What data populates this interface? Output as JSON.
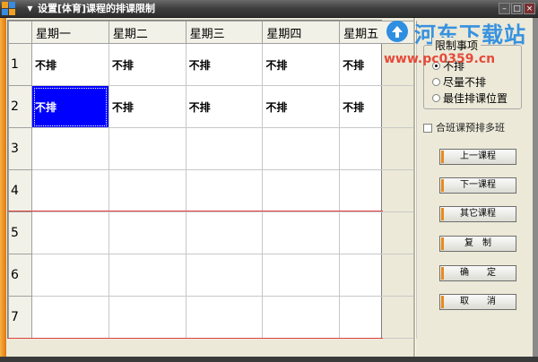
{
  "window": {
    "title": "设置[体育]课程的排课限制"
  },
  "timetable": {
    "day_headers": [
      "星期一",
      "星期二",
      "星期三",
      "星期四",
      "星期五"
    ],
    "rows": [
      {
        "label": "1",
        "cells": [
          "不排",
          "不排",
          "不排",
          "不排",
          "不排"
        ]
      },
      {
        "label": "2",
        "cells": [
          "不排",
          "不排",
          "不排",
          "不排",
          "不排"
        ]
      },
      {
        "label": "3",
        "cells": [
          "",
          "",
          "",
          "",
          ""
        ]
      },
      {
        "label": "4",
        "cells": [
          "",
          "",
          "",
          "",
          ""
        ]
      },
      {
        "label": "5",
        "cells": [
          "",
          "",
          "",
          "",
          ""
        ]
      },
      {
        "label": "6",
        "cells": [
          "",
          "",
          "",
          "",
          ""
        ]
      },
      {
        "label": "7",
        "cells": [
          "",
          "",
          "",
          "",
          ""
        ]
      }
    ],
    "selected_cell": {
      "row": 2,
      "day": 1
    }
  },
  "restrictions": {
    "group_title": "限制事项",
    "options": [
      {
        "label": "不排",
        "selected": true
      },
      {
        "label": "尽量不排",
        "selected": false
      },
      {
        "label": "最佳排课位置",
        "selected": false
      }
    ]
  },
  "merge_class": {
    "label": "合班课预排多班",
    "checked": false
  },
  "buttons": {
    "prev_course": "上一课程",
    "next_course": "下一课程",
    "other_course": "其它课程",
    "copy": "复　制",
    "confirm": "确　　定",
    "cancel": "取　　消"
  },
  "watermark": {
    "site_name": "河东下载站",
    "url": "www.pc0359.cn"
  },
  "colors": {
    "selection": "#0000ff",
    "accent_orange": "#e88a1a",
    "watermark_blue": "#2e8ee0",
    "watermark_red": "#e53a2a"
  }
}
